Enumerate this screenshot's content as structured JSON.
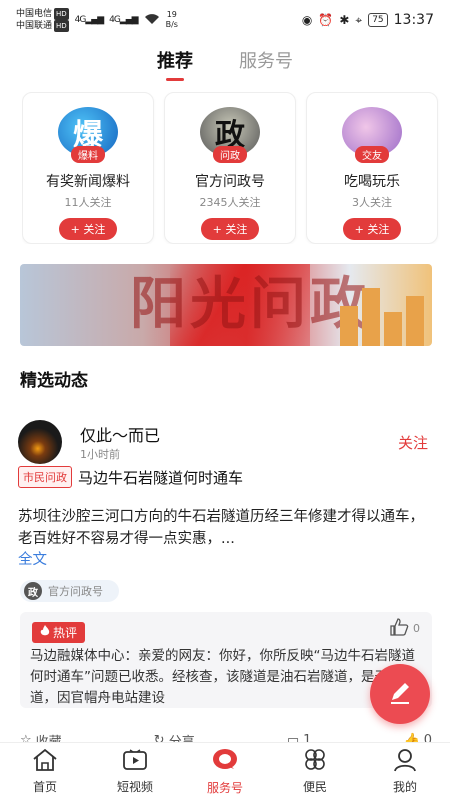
{
  "status_bar": {
    "carrier1": "中国电信",
    "carrier2": "中国联通",
    "hd": "HD",
    "net": "4G",
    "speed_value": "19",
    "speed_unit": "B/s",
    "battery": "75",
    "time": "13:37"
  },
  "top_tabs": [
    {
      "label": "推荐",
      "active": true
    },
    {
      "label": "服务号",
      "active": false
    }
  ],
  "cards": [
    {
      "avatar_text": "爆",
      "tag": "爆料",
      "name": "有奖新闻爆料",
      "count": "11人关注",
      "follow": "+ 关注"
    },
    {
      "avatar_text": "政",
      "tag": "问政",
      "name": "官方问政号",
      "count": "2345人关注",
      "follow": "+ 关注"
    },
    {
      "avatar_text": "",
      "tag": "交友",
      "name": "吃喝玩乐",
      "count": "3人关注",
      "follow": "+ 关注"
    }
  ],
  "section_title": "精选动态",
  "post": {
    "author": "仅此～而已",
    "time": "1小时前",
    "follow": "关注",
    "topic_tag": "市民问政",
    "topic_title": "马边牛石岩隧道何时通车",
    "body": "苏坝往沙腔三河口方向的牛石岩隧道历经三年修建才得以通车，老百姓好不容易才得一点实惠，...",
    "more": "全文",
    "source": "官方问政号",
    "source_icon": "政",
    "hot_label": "热评",
    "hot_like_count": "0",
    "hot_author": "马边融媒体中心：",
    "hot_text": "亲爱的网友：你好，你所反映“马边牛石岩隧道何时通车”问题已收悉。经核查，该隧道是油石岩隧道，是干沟隧道，因官帽舟电站建设",
    "actions": [
      {
        "icon": "star-icon",
        "label": "收藏"
      },
      {
        "icon": "share-icon",
        "label": "分享"
      },
      {
        "icon": "comment-icon",
        "label": "1"
      },
      {
        "icon": "thumbs-up-icon",
        "label": "0"
      }
    ]
  },
  "bottom_nav": [
    {
      "icon": "home-icon",
      "label": "首页",
      "active": false
    },
    {
      "icon": "video-icon",
      "label": "短视频",
      "active": false
    },
    {
      "icon": "service-icon",
      "label": "服务号",
      "active": true
    },
    {
      "icon": "clover-icon",
      "label": "便民",
      "active": false
    },
    {
      "icon": "user-icon",
      "label": "我的",
      "active": false
    }
  ],
  "colors": {
    "accent": "#e23b3b",
    "link": "#3b7ddd",
    "fab": "#ec4b52"
  }
}
